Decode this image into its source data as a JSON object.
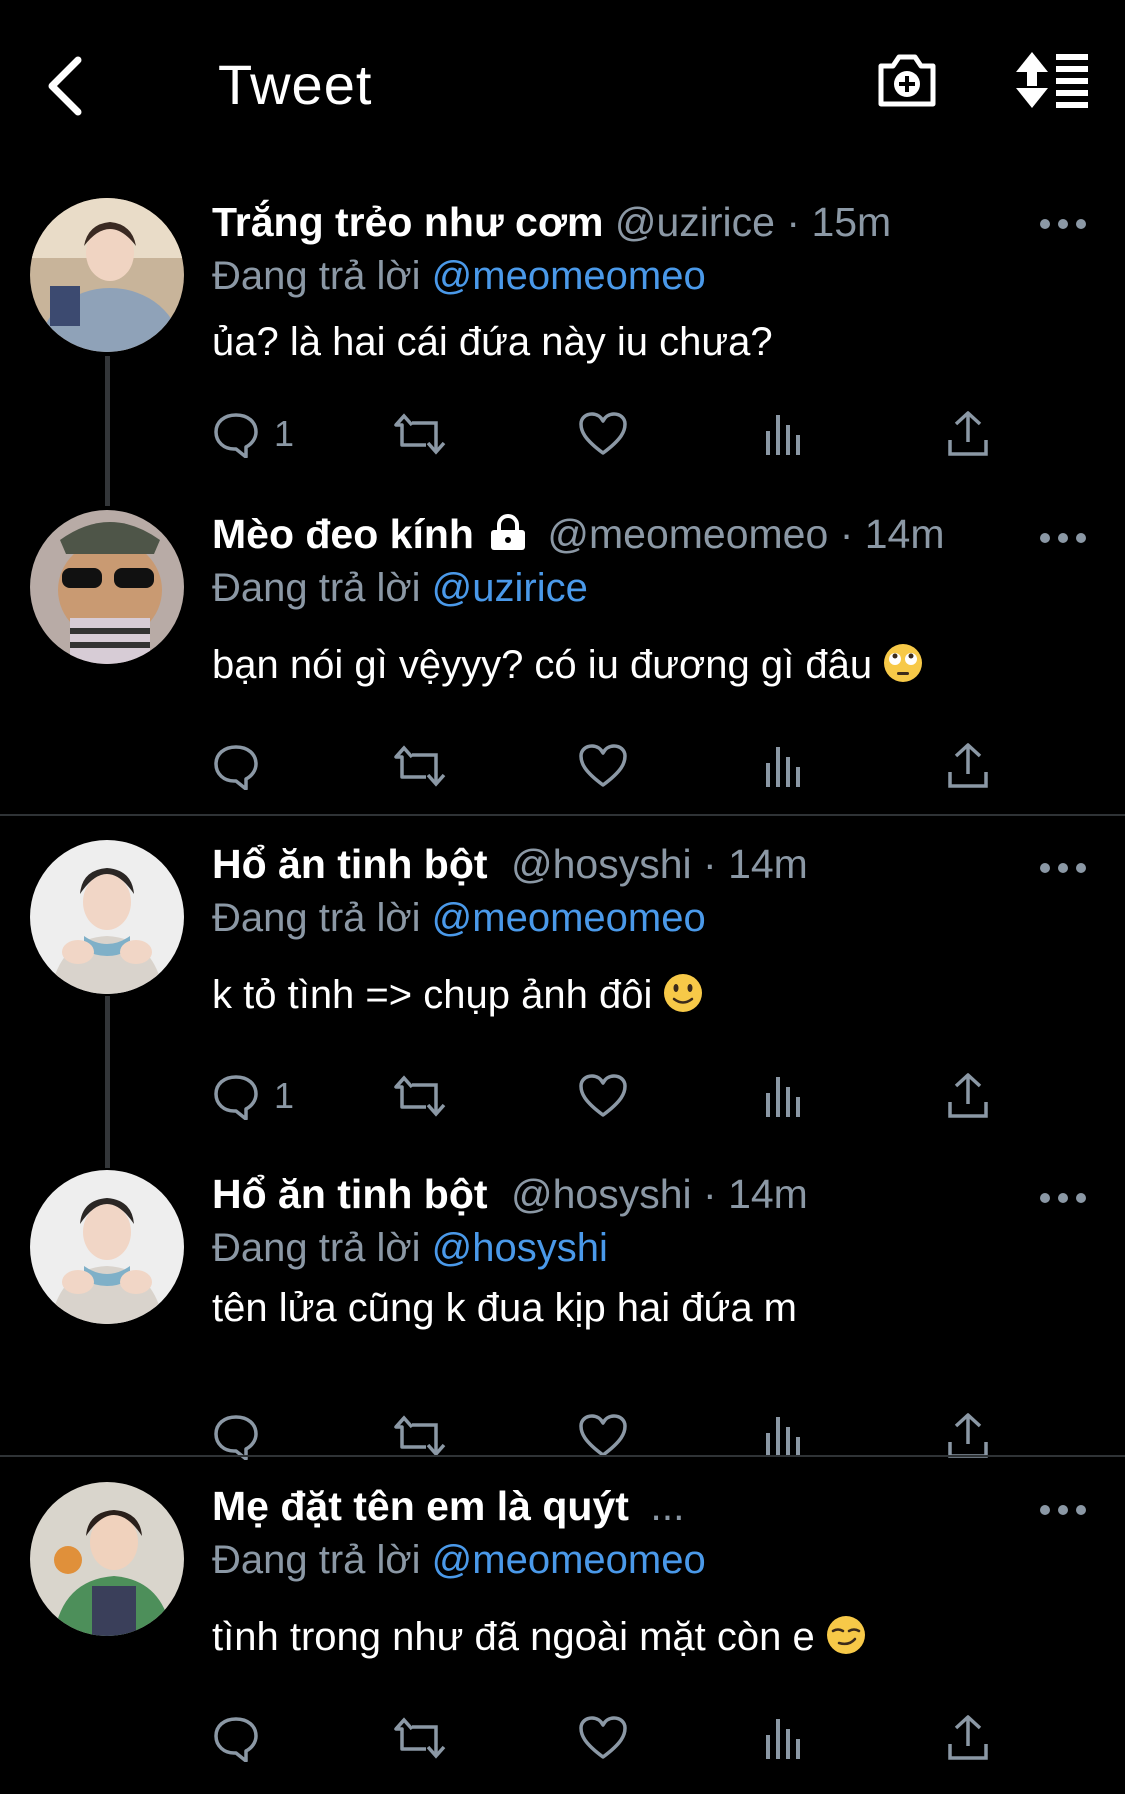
{
  "header": {
    "title": "Tweet"
  },
  "tweets": [
    {
      "name": "Trắng trẻo như cơm",
      "handle": "@uzirice",
      "sep": "·",
      "time": "15m",
      "reply_prefix": "Đang trả lời",
      "reply_to": "@meomeomeo",
      "text": "ủa? là hai cái đứa này iu chưa?",
      "reply_count": "1"
    },
    {
      "name": "Mèo đeo kính",
      "handle": "@meomeomeo",
      "sep": "·",
      "time": "14m",
      "reply_prefix": "Đang trả lời",
      "reply_to": "@uzirice",
      "text": "bạn nói gì vệyyy? có iu đương gì đâu",
      "emoji": "face-with-rolling-eyes",
      "reply_count": ""
    },
    {
      "name": "Hổ ăn tinh bột",
      "handle": "@hosyshi",
      "sep": "·",
      "time": "14m",
      "reply_prefix": "Đang trả lời",
      "reply_to": "@meomeomeo",
      "text": "k tỏ tình => chụp ảnh đôi",
      "emoji": "slightly-smiling-face",
      "reply_count": "1"
    },
    {
      "name": "Hổ ăn tinh bột",
      "handle": "@hosyshi",
      "sep": "·",
      "time": "14m",
      "reply_prefix": "Đang trả lời",
      "reply_to": "@hosyshi",
      "text": "tên lửa cũng k đua kịp hai đứa m",
      "reply_count": ""
    },
    {
      "name": "Mẹ đặt tên em là quýt",
      "handle": "",
      "sep": "...",
      "time": "",
      "reply_prefix": "Đang trả lời",
      "reply_to": "@meomeomeo",
      "text": "tình trong như đã ngoài mặt còn e",
      "emoji": "smirking-face",
      "reply_count": ""
    }
  ],
  "colors": {
    "background": "#000000",
    "text": "#ffffff",
    "muted": "#8b98a5",
    "mention": "#4a99e9",
    "divider": "#2f3336"
  }
}
